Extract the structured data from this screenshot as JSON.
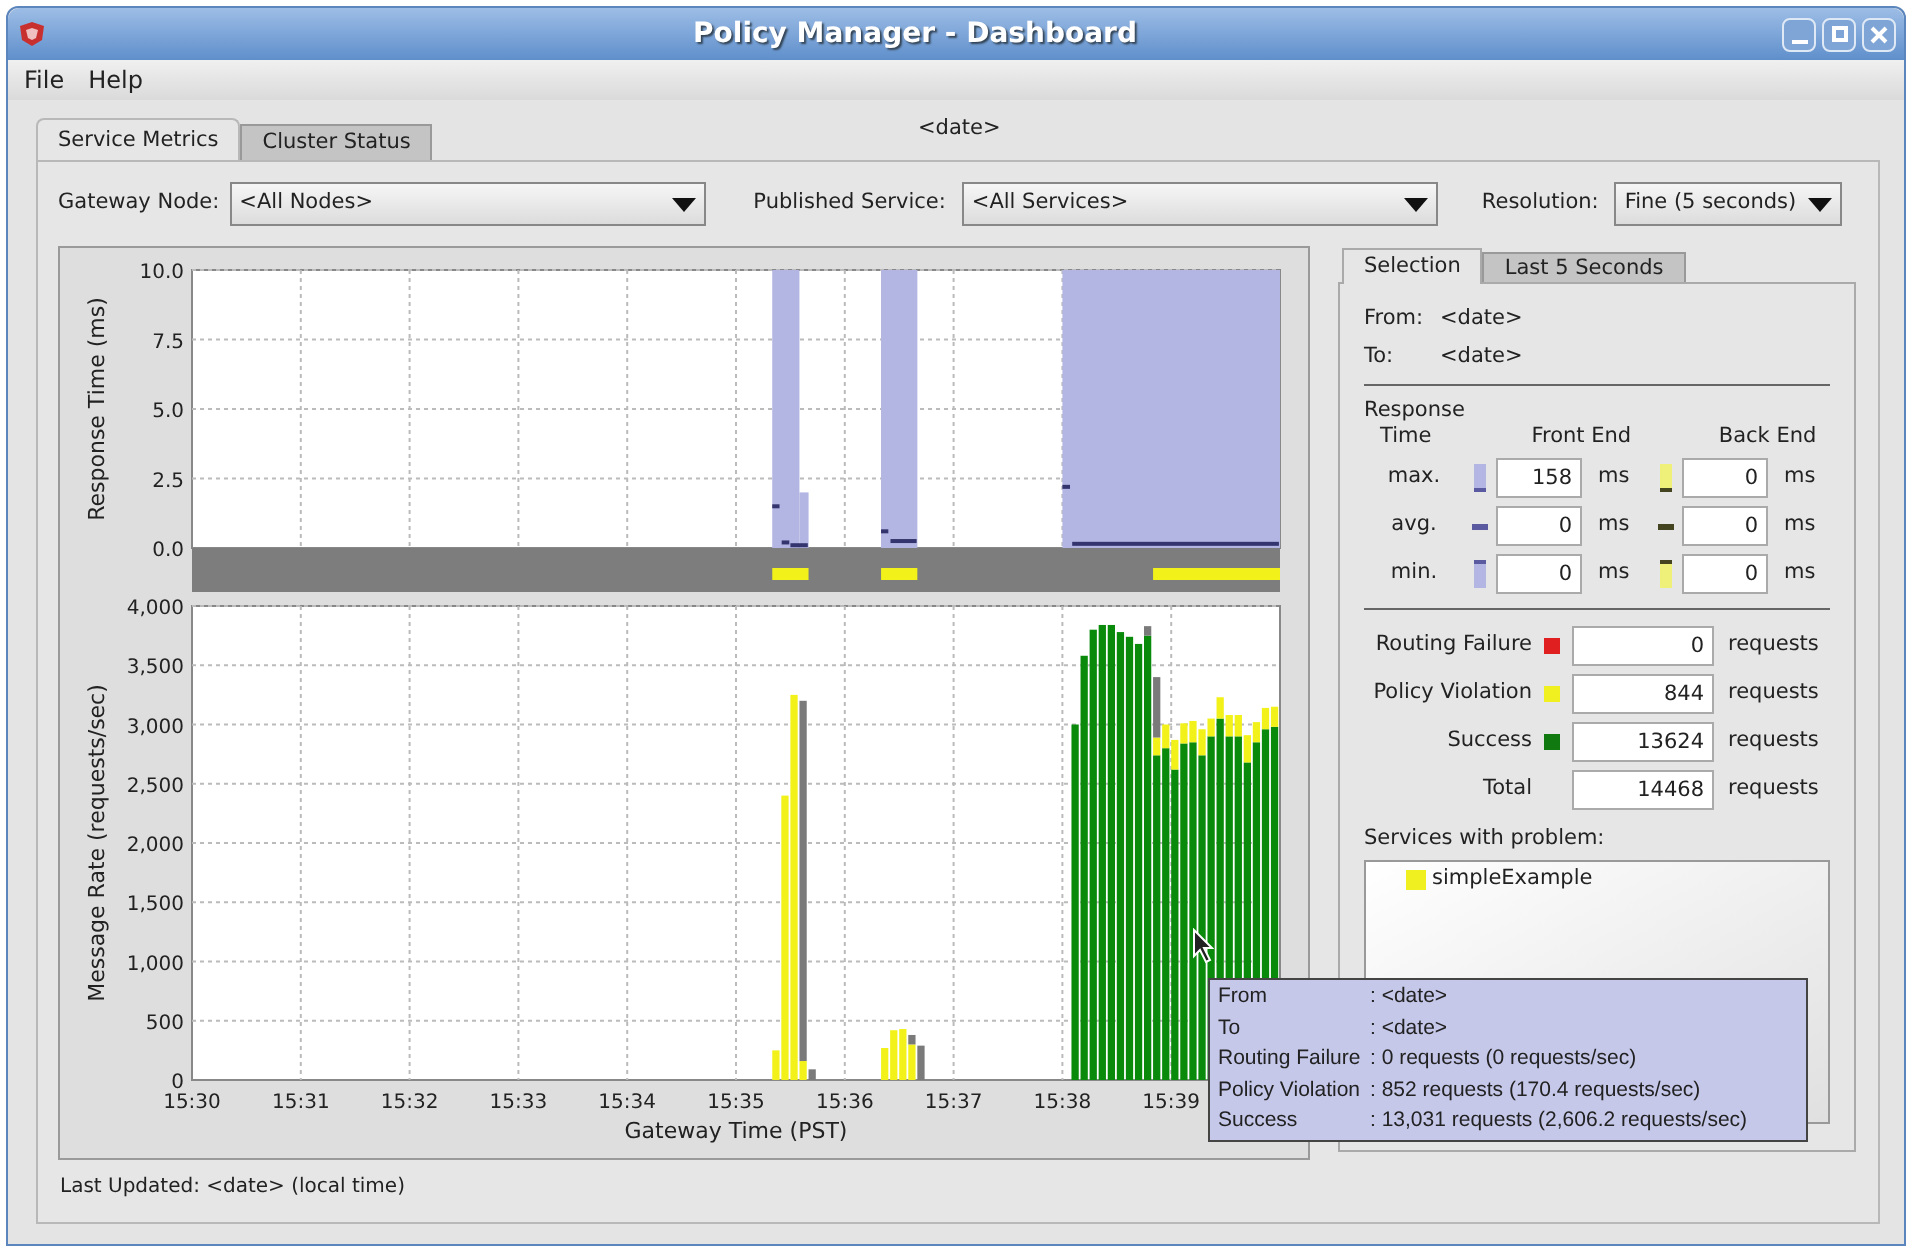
{
  "window": {
    "title": "Policy Manager - Dashboard"
  },
  "menu": [
    {
      "label": "File"
    },
    {
      "label": "Help"
    }
  ],
  "tabs": [
    {
      "label": "Service Metrics",
      "selected": true
    },
    {
      "label": "Cluster Status",
      "selected": false
    }
  ],
  "date": "<date>",
  "filters": [
    {
      "label": "Gateway Node:",
      "value": "<All Nodes>"
    },
    {
      "label": "Published Service:",
      "value": "<All Services>"
    },
    {
      "label": "Resolution:",
      "value": "Fine (5 seconds)"
    }
  ],
  "response_chart": {
    "ylabel": "Response Time (ms)",
    "yticks": [
      "10.0",
      "7.5",
      "5.0",
      "2.5",
      "0.0"
    ]
  },
  "rate_chart": {
    "chart_data": {
      "type": "bar",
      "stacked": true,
      "grid": true,
      "xlabel": "Gateway Time (PST)",
      "ylabel": "Message Rate (requests/sec)",
      "ylim": [
        0,
        4000
      ],
      "yticks": [
        {
          "value": 0,
          "label": "0"
        },
        {
          "value": 500,
          "label": "500"
        },
        {
          "value": 1000,
          "label": "1,000"
        },
        {
          "value": 1500,
          "label": "1,500"
        },
        {
          "value": 2000,
          "label": "2,000"
        },
        {
          "value": 2500,
          "label": "2,500"
        },
        {
          "value": 3000,
          "label": "3,000"
        },
        {
          "value": 3500,
          "label": "3,500"
        },
        {
          "value": 4000,
          "label": "4,000"
        }
      ],
      "categories": [
        "15:30",
        null,
        null,
        null,
        null,
        null,
        null,
        null,
        null,
        null,
        null,
        null,
        "15:31",
        null,
        null,
        null,
        null,
        null,
        null,
        null,
        null,
        null,
        null,
        null,
        "15:32",
        null,
        null,
        null,
        null,
        null,
        null,
        null,
        null,
        null,
        null,
        null,
        "15:33",
        null,
        null,
        null,
        null,
        null,
        null,
        null,
        null,
        null,
        null,
        null,
        "15:34",
        null,
        null,
        null,
        null,
        null,
        null,
        null,
        null,
        null,
        null,
        null,
        "15:35",
        null,
        null,
        null,
        null,
        null,
        null,
        null,
        null,
        null,
        null,
        null,
        "15:36",
        null,
        null,
        null,
        null,
        null,
        null,
        null,
        null,
        null,
        null,
        null,
        "15:37",
        null,
        null,
        null,
        null,
        null,
        null,
        null,
        null,
        null,
        null,
        null,
        "15:38",
        null,
        null,
        null,
        null,
        null,
        null,
        null,
        null,
        null,
        null,
        null,
        "15:39",
        null,
        null,
        null,
        null,
        null,
        null,
        null,
        null,
        null,
        null,
        null
      ],
      "series": [
        {
          "color": "#0a8a0a",
          "values": [
            0,
            0,
            0,
            0,
            0,
            0,
            0,
            0,
            0,
            0,
            0,
            0,
            0,
            0,
            0,
            0,
            0,
            0,
            0,
            0,
            0,
            0,
            0,
            0,
            0,
            0,
            0,
            0,
            0,
            0,
            0,
            0,
            0,
            0,
            0,
            0,
            0,
            0,
            0,
            0,
            0,
            0,
            0,
            0,
            0,
            0,
            0,
            0,
            0,
            0,
            0,
            0,
            0,
            0,
            0,
            0,
            0,
            0,
            0,
            0,
            0,
            0,
            0,
            0,
            0,
            0,
            0,
            0,
            0,
            0,
            0,
            0,
            0,
            0,
            0,
            0,
            0,
            0,
            0,
            0,
            0,
            0,
            0,
            0,
            0,
            0,
            0,
            0,
            0,
            0,
            0,
            0,
            0,
            0,
            0,
            0,
            0,
            3000,
            3580,
            3800,
            3840,
            3840,
            3780,
            3740,
            3680,
            3750,
            2740,
            2800,
            2620,
            2840,
            2850,
            2740,
            2900,
            3050,
            2900,
            2900,
            2680,
            2850,
            2960,
            2980
          ]
        },
        {
          "color": "#f2f21a",
          "values": [
            0,
            0,
            0,
            0,
            0,
            0,
            0,
            0,
            0,
            0,
            0,
            0,
            0,
            0,
            0,
            0,
            0,
            0,
            0,
            0,
            0,
            0,
            0,
            0,
            0,
            0,
            0,
            0,
            0,
            0,
            0,
            0,
            0,
            0,
            0,
            0,
            0,
            0,
            0,
            0,
            0,
            0,
            0,
            0,
            0,
            0,
            0,
            0,
            0,
            0,
            0,
            0,
            0,
            0,
            0,
            0,
            0,
            0,
            0,
            0,
            0,
            0,
            0,
            0,
            250,
            2400,
            3250,
            160,
            0,
            0,
            0,
            0,
            0,
            0,
            0,
            0,
            270,
            420,
            430,
            300,
            0,
            0,
            0,
            0,
            0,
            0,
            0,
            0,
            0,
            0,
            0,
            0,
            0,
            0,
            0,
            0,
            0,
            0,
            0,
            0,
            0,
            0,
            0,
            0,
            0,
            0,
            150,
            200,
            250,
            170,
            180,
            220,
            150,
            180,
            180,
            180,
            230,
            170,
            180,
            170
          ]
        },
        {
          "color": "#7a7a7a",
          "values": [
            0,
            0,
            0,
            0,
            0,
            0,
            0,
            0,
            0,
            0,
            0,
            0,
            0,
            0,
            0,
            0,
            0,
            0,
            0,
            0,
            0,
            0,
            0,
            0,
            0,
            0,
            0,
            0,
            0,
            0,
            0,
            0,
            0,
            0,
            0,
            0,
            0,
            0,
            0,
            0,
            0,
            0,
            0,
            0,
            0,
            0,
            0,
            0,
            0,
            0,
            0,
            0,
            0,
            0,
            0,
            0,
            0,
            0,
            0,
            0,
            0,
            0,
            0,
            0,
            0,
            0,
            0,
            3040,
            90,
            0,
            0,
            0,
            0,
            0,
            0,
            0,
            0,
            0,
            0,
            80,
            290,
            0,
            0,
            0,
            0,
            0,
            0,
            0,
            0,
            0,
            0,
            0,
            0,
            0,
            0,
            0,
            0,
            0,
            0,
            0,
            0,
            0,
            0,
            0,
            0,
            80,
            510,
            0,
            0,
            0,
            0,
            0,
            0,
            0,
            0,
            0,
            0,
            0,
            0,
            0
          ]
        }
      ]
    }
  },
  "side_tabs": [
    {
      "label": "Selection",
      "selected": true
    },
    {
      "label": "Last 5 Seconds",
      "selected": false
    }
  ],
  "selection": {
    "from_label": "From:",
    "from": "<date>",
    "to_label": "To:",
    "to": "<date>",
    "response_title": "Response",
    "time_label": "Time",
    "front_label": "Front End",
    "back_label": "Back End",
    "rows": [
      {
        "kind": "max",
        "label": "max.",
        "front": "158",
        "front_unit": "ms",
        "back": "0",
        "back_unit": "ms"
      },
      {
        "kind": "avg",
        "label": "avg.",
        "front": "0",
        "front_unit": "ms",
        "back": "0",
        "back_unit": "ms"
      },
      {
        "kind": "min",
        "label": "min.",
        "front": "0",
        "front_unit": "ms",
        "back": "0",
        "back_unit": "ms"
      }
    ],
    "counts": [
      {
        "label": "Routing Failure",
        "color": "#e02020",
        "value": "0",
        "unit": "requests"
      },
      {
        "label": "Policy Violation",
        "color": "#f0f020",
        "value": "844",
        "unit": "requests"
      },
      {
        "label": "Success",
        "color": "#107a10",
        "value": "13624",
        "unit": "requests"
      },
      {
        "label": "Total",
        "value": "14468",
        "unit": "requests"
      }
    ],
    "services_label": "Services with problem:",
    "services": [
      {
        "name": "simpleExample",
        "color": "#f0f020"
      }
    ]
  },
  "tooltip": [
    {
      "label": "From",
      "value": ": <date>"
    },
    {
      "label": "To",
      "value": ": <date>"
    },
    {
      "label": "Routing Failure",
      "value": ": 0 requests (0 requests/sec)"
    },
    {
      "label": "Policy Violation",
      "value": ": 852 requests (170.4 requests/sec)"
    },
    {
      "label": "Success",
      "value": ": 13,031 requests (2,606.2 requests/sec)"
    }
  ],
  "status": "Last Updated: <date> (local time)"
}
